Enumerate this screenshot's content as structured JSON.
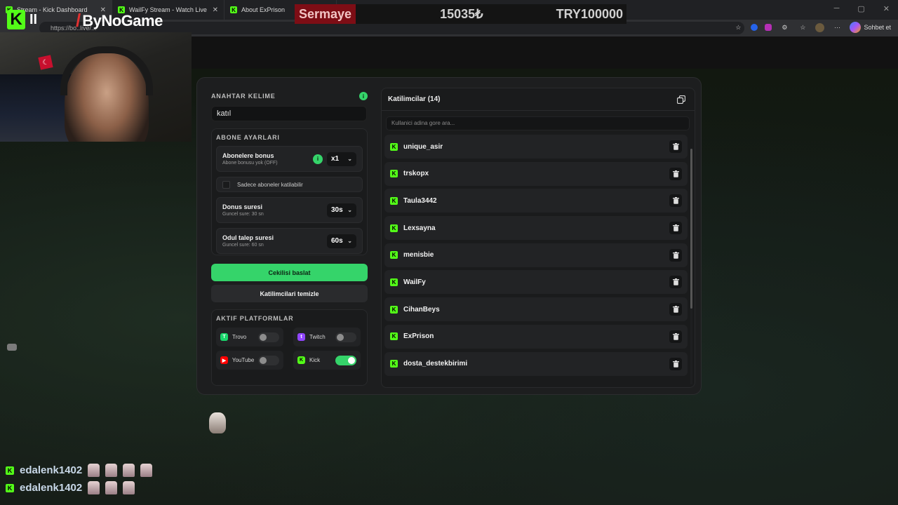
{
  "browser": {
    "tabs": [
      {
        "title": "Stream - Kick Dashboard",
        "active": true
      },
      {
        "title": "WailFy Stream - Watch Live on Kick",
        "active": false
      },
      {
        "title": "About ExPrison",
        "active": false
      }
    ],
    "url": "https://bo..live/...",
    "chat_button": "Sohbet et"
  },
  "overlay": {
    "brand_name": "ByNoGame",
    "sermaye": {
      "label": "Sermaye",
      "value": "15035₺",
      "target": "TRY100000"
    }
  },
  "raffle": {
    "keyword": {
      "label": "ANAHTAR KELIME",
      "value": "katıl"
    },
    "subscriber_settings": {
      "label": "ABONE AYARLARI",
      "bonus_title": "Abonelere bonus",
      "bonus_sub": "Abone bonusu yok (OFF)",
      "bonus_value": "x1",
      "only_subs_label": "Sadece aboneler katilabilir",
      "duration_title": "Donus suresi",
      "duration_sub": "Guncel sure: 30 sn",
      "duration_value": "30s",
      "claim_title": "Odul talep suresi",
      "claim_sub": "Guncel sure: 60 sn",
      "claim_value": "60s"
    },
    "start_button": "Cekilisi baslat",
    "clear_button": "Katilimcilari temizle",
    "platforms": {
      "label": "AKTIF PLATFORMLAR",
      "items": [
        {
          "name": "Trovo",
          "enabled": false,
          "color": "#19d66b"
        },
        {
          "name": "Twitch",
          "enabled": false,
          "color": "#9146ff"
        },
        {
          "name": "YouTube",
          "enabled": false,
          "color": "#ff0000"
        },
        {
          "name": "Kick",
          "enabled": true,
          "color": "#53fc18"
        }
      ]
    },
    "participants": {
      "title": "Katilimcilar (14)",
      "search_placeholder": "Kullanici adina gore ara...",
      "list": [
        "unique_asir",
        "trskopx",
        "Taula3442",
        "Lexsayna",
        "menisbie",
        "WailFy",
        "CihanBeys",
        "ExPrison",
        "dosta_destekbirimi"
      ]
    }
  },
  "chat": {
    "messages": [
      {
        "user": "edalenk1402",
        "emotes": 4
      },
      {
        "user": "edalenk1402",
        "emotes": 3
      }
    ]
  },
  "colors": {
    "accent_green": "#35d46a",
    "kick_green": "#53fc18",
    "sermaye_red": "#7d0d15"
  }
}
